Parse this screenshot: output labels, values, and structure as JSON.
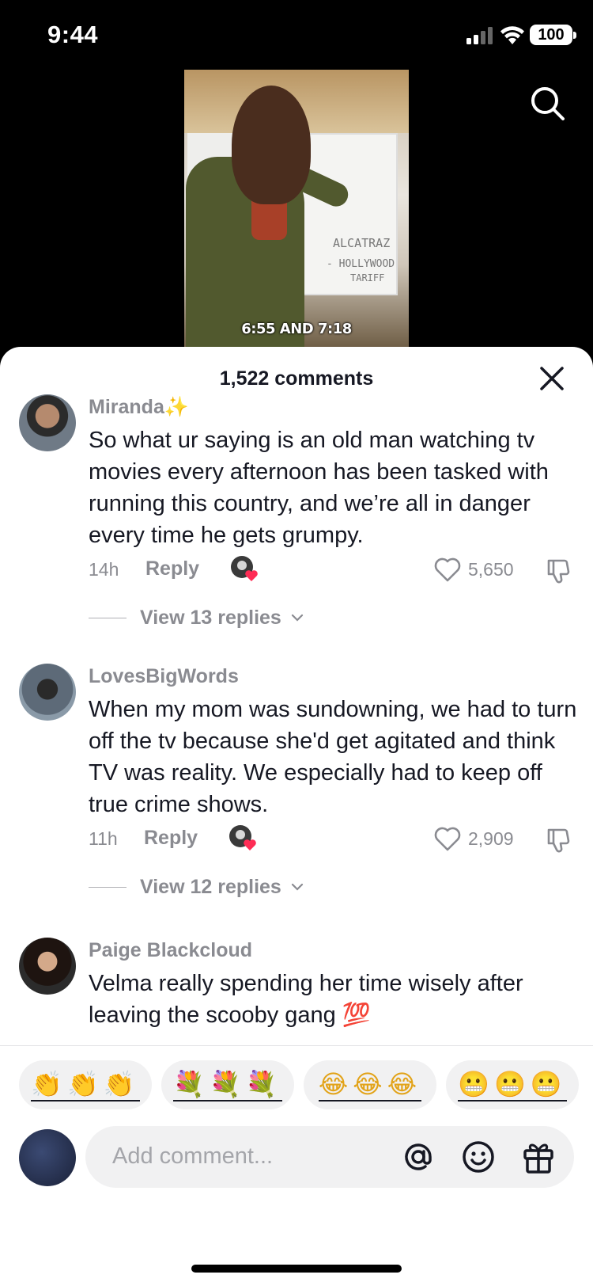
{
  "status_bar": {
    "time": "9:44",
    "battery": "100"
  },
  "video": {
    "caption": "6:55 AND 7:18",
    "board_lines": [
      "ALCATRAZ",
      "- HOLLYWOOD",
      "TARIFF"
    ]
  },
  "sheet": {
    "title": "1,522 comments"
  },
  "comments": [
    {
      "username": "Miranda✨",
      "text": "So what ur saying is an old man watching tv movies every afternoon has been tasked with running this country, and we’re all in danger every time he gets grumpy.",
      "time": "14h",
      "reply_label": "Reply",
      "likes": "5,650",
      "view_replies": "View 13 replies"
    },
    {
      "username": "LovesBigWords",
      "text": "When my mom was sundowning, we had to turn off the tv because she'd get agitated and think TV was reality. We especially had to keep off true crime shows.",
      "time": "11h",
      "reply_label": "Reply",
      "likes": "2,909",
      "view_replies": "View 12 replies"
    },
    {
      "username": "Paige Blackcloud",
      "text": "Velma really spending her time wisely after leaving the scooby gang 💯"
    }
  ],
  "quick_emojis": [
    "👏👏👏",
    "💐💐💐",
    "😂😂😂",
    "😬😬😬"
  ],
  "composer": {
    "placeholder": "Add comment..."
  }
}
